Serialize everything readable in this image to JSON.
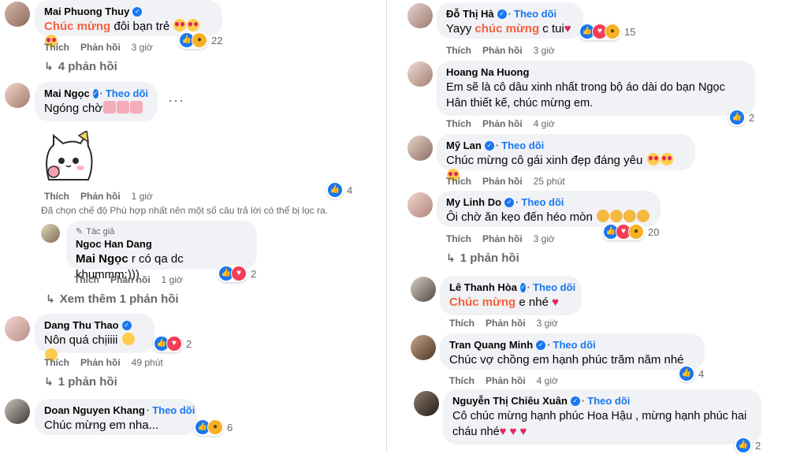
{
  "ui": {
    "like": "Thích",
    "reply": "Phản hồi",
    "follow": "Theo dõi",
    "author_tag": "Tác giả"
  },
  "colors": {
    "accent": "#1877f2",
    "highlight": "#f56040",
    "meta_text": "#65676b",
    "bubble": "#f0f2f5"
  },
  "filter_note": "Đã chọn chế độ Phù hợp nhất nên một số câu trả lời có thể bị lọc ra.",
  "left": {
    "c1": {
      "name": "Mai Phuong Thuy",
      "hl": "Chúc mừng",
      "text": " đôi bạn trẻ",
      "time": "3 giờ",
      "count": "22",
      "replies": "4 phản hồi"
    },
    "c2": {
      "name": "Mai Ngọc",
      "text": "Ngóng chờ",
      "time": "1 giờ",
      "count": "4",
      "sticker": "cat-sticker"
    },
    "c3": {
      "name": "Ngoc Han Dang",
      "mention": "Mai Ngọc",
      "text": " r có qa dc khummm:)))",
      "time": "1 giờ",
      "count": "2",
      "more": "Xem thêm 1 phản hồi"
    },
    "c4": {
      "name": "Dang Thu Thao",
      "text": "Nôn quá chịiiii",
      "time": "49 phút",
      "count": "2",
      "replies": "1 phản hồi"
    },
    "c5": {
      "name": "Doan Nguyen Khang",
      "text": "Chúc mừng em nha...",
      "count": "6"
    }
  },
  "right": {
    "c1": {
      "name": "Đỗ Thị Hà",
      "pre": "Yayy ",
      "hl": "chúc mừng",
      "text": " c tui",
      "time": "3 giờ",
      "count": "15"
    },
    "c2": {
      "name": "Hoang Na Huong",
      "text": "Em sẽ là cô dâu xinh nhất trong bộ áo dài do bạn Ngọc Hân thiết kế, chúc mừng em.",
      "time": "4 giờ",
      "count": "2"
    },
    "c3": {
      "name": "Mỹ Lan",
      "text": "Chúc mừng cô gái xinh đẹp đáng yêu",
      "time": "25 phút"
    },
    "c4": {
      "name": "My Linh Do",
      "text": "Ôi chờ ăn kẹo đến héo mòn",
      "time": "3 giờ",
      "count": "20",
      "replies": "1 phản hồi"
    },
    "c5": {
      "name": "Lê Thanh Hòa",
      "hl": "Chúc mừng",
      "text": " e nhé",
      "time": "3 giờ"
    },
    "c6": {
      "name": "Tran Quang Minh",
      "text": "Chúc vợ chồng em hạnh phúc trăm năm nhé",
      "time": "4 giờ",
      "count": "4"
    },
    "c7": {
      "name": "Nguyễn Thị Chiêu Xuân",
      "text": "Cô chúc mừng hạnh phúc Hoa Hậu , mừng hạnh phúc hai cháu nhé",
      "count": "2"
    }
  }
}
